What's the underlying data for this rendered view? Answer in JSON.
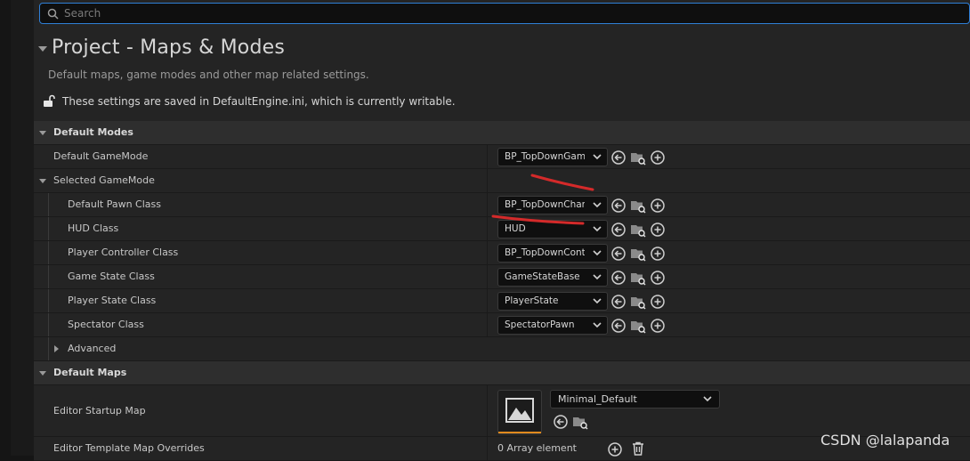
{
  "search": {
    "placeholder": "Search"
  },
  "section": {
    "title": "Project - Maps & Modes",
    "description": "Default maps, game modes and other map related settings.",
    "lock_text": "These settings are saved in DefaultEngine.ini, which is currently writable."
  },
  "default_modes": {
    "label": "Default Modes",
    "default_gamemode": {
      "label": "Default GameMode",
      "value": "BP_TopDownGameMode"
    },
    "selected_gamemode": {
      "label": "Selected GameMode",
      "rows": [
        {
          "label": "Default Pawn Class",
          "value": "BP_TopDownCharacter"
        },
        {
          "label": "HUD Class",
          "value": "HUD"
        },
        {
          "label": "Player Controller Class",
          "value": "BP_TopDownController"
        },
        {
          "label": "Game State Class",
          "value": "GameStateBase"
        },
        {
          "label": "Player State Class",
          "value": "PlayerState"
        },
        {
          "label": "Spectator Class",
          "value": "SpectatorPawn"
        }
      ],
      "advanced_label": "Advanced"
    }
  },
  "default_maps": {
    "label": "Default Maps",
    "editor_startup_map": {
      "label": "Editor Startup Map",
      "value": "Minimal_Default"
    },
    "editor_template_overrides": {
      "label": "Editor Template Map Overrides",
      "value": "0 Array element"
    }
  },
  "colors": {
    "accent": "#2f7fd6",
    "thumbnail_bar": "#e08a1e",
    "annotation": "#d42a2a"
  },
  "watermark": "CSDN @lalapanda"
}
